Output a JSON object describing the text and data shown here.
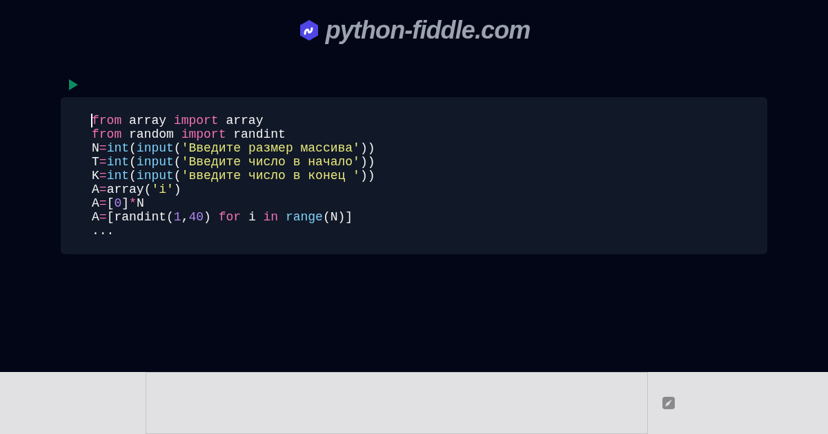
{
  "header": {
    "site_name": "python-fiddle.com"
  },
  "code_lines": [
    [
      {
        "kind": "kw",
        "text": "from"
      },
      {
        "kind": "plain",
        "text": " array "
      },
      {
        "kind": "kw",
        "text": "import"
      },
      {
        "kind": "plain",
        "text": " array"
      }
    ],
    [
      {
        "kind": "kw",
        "text": "from"
      },
      {
        "kind": "plain",
        "text": " random "
      },
      {
        "kind": "kw",
        "text": "import"
      },
      {
        "kind": "plain",
        "text": " randint"
      }
    ],
    [
      {
        "kind": "plain",
        "text": "N"
      },
      {
        "kind": "op",
        "text": "="
      },
      {
        "kind": "fn",
        "text": "int"
      },
      {
        "kind": "plain",
        "text": "("
      },
      {
        "kind": "fn",
        "text": "input"
      },
      {
        "kind": "plain",
        "text": "("
      },
      {
        "kind": "str",
        "text": "'Введите размер массива'"
      },
      {
        "kind": "plain",
        "text": "))"
      }
    ],
    [
      {
        "kind": "plain",
        "text": "T"
      },
      {
        "kind": "op",
        "text": "="
      },
      {
        "kind": "fn",
        "text": "int"
      },
      {
        "kind": "plain",
        "text": "("
      },
      {
        "kind": "fn",
        "text": "input"
      },
      {
        "kind": "plain",
        "text": "("
      },
      {
        "kind": "str",
        "text": "'Введите число в начало'"
      },
      {
        "kind": "plain",
        "text": "))"
      }
    ],
    [
      {
        "kind": "plain",
        "text": "K"
      },
      {
        "kind": "op",
        "text": "="
      },
      {
        "kind": "fn",
        "text": "int"
      },
      {
        "kind": "plain",
        "text": "("
      },
      {
        "kind": "fn",
        "text": "input"
      },
      {
        "kind": "plain",
        "text": "("
      },
      {
        "kind": "str",
        "text": "'введите число в конец '"
      },
      {
        "kind": "plain",
        "text": "))"
      }
    ],
    [
      {
        "kind": "plain",
        "text": "A"
      },
      {
        "kind": "op",
        "text": "="
      },
      {
        "kind": "plain",
        "text": "array("
      },
      {
        "kind": "str",
        "text": "'i'"
      },
      {
        "kind": "plain",
        "text": ")"
      }
    ],
    [
      {
        "kind": "plain",
        "text": "A"
      },
      {
        "kind": "op",
        "text": "="
      },
      {
        "kind": "plain",
        "text": "["
      },
      {
        "kind": "num",
        "text": "0"
      },
      {
        "kind": "plain",
        "text": "]"
      },
      {
        "kind": "op",
        "text": "*"
      },
      {
        "kind": "plain",
        "text": "N"
      }
    ],
    [
      {
        "kind": "plain",
        "text": "A"
      },
      {
        "kind": "op",
        "text": "="
      },
      {
        "kind": "plain",
        "text": "[randint("
      },
      {
        "kind": "num",
        "text": "1"
      },
      {
        "kind": "plain",
        "text": ","
      },
      {
        "kind": "num",
        "text": "40"
      },
      {
        "kind": "plain",
        "text": ") "
      },
      {
        "kind": "kw",
        "text": "for"
      },
      {
        "kind": "plain",
        "text": " i "
      },
      {
        "kind": "kw",
        "text": "in"
      },
      {
        "kind": "fn",
        "text": " range"
      },
      {
        "kind": "plain",
        "text": "(N)]"
      }
    ],
    [
      {
        "kind": "plain",
        "text": "..."
      }
    ]
  ]
}
